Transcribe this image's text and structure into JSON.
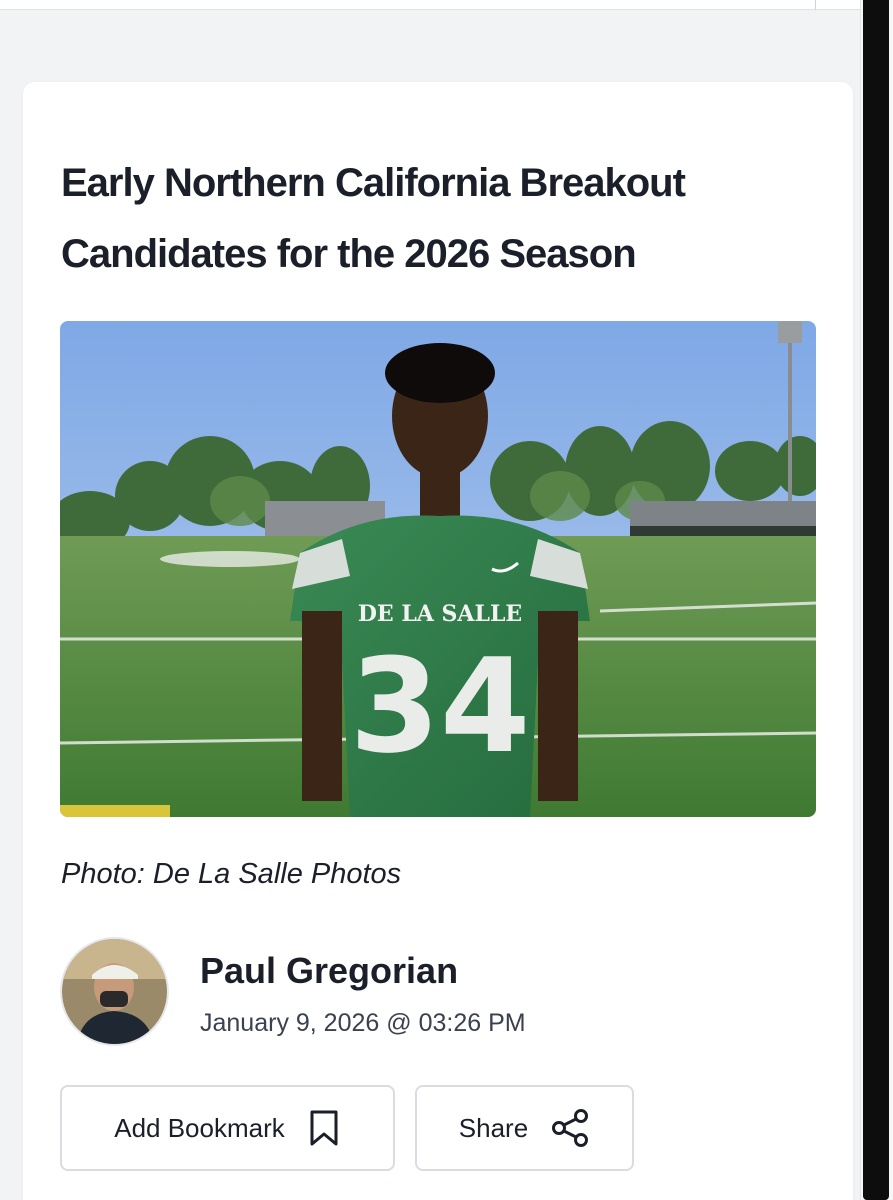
{
  "article": {
    "title": "Early Northern California Breakout Candidates for the 2026 Season",
    "photo_credit": "Photo: De La Salle Photos",
    "hero_image": {
      "jersey_name": "DE LA SALLE",
      "jersey_number": "34"
    }
  },
  "author": {
    "name": "Paul Gregorian",
    "date": "January 9, 2026 @ 03:26 PM"
  },
  "actions": {
    "bookmark_label": "Add Bookmark",
    "bookmark_icon": "bookmark-icon",
    "share_label": "Share",
    "share_icon": "share-icon"
  },
  "colors": {
    "jersey_green": "#2f7d4a",
    "field_green": "#4f8a3d",
    "sky_blue": "#8fb4e8"
  }
}
